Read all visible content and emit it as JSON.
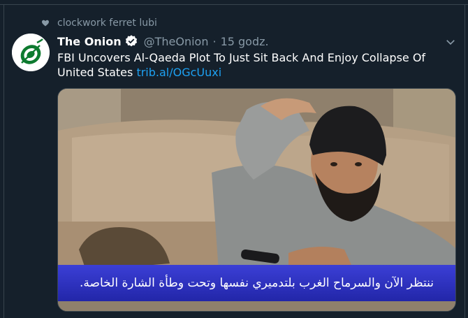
{
  "social_context": {
    "icon": "heart-icon",
    "text": "clockwork ferret lubi"
  },
  "tweet": {
    "avatar_icon": "onion-logo",
    "display_name": "The Onion",
    "verified_icon": "verified-badge-icon",
    "handle": "@TheOnion",
    "separator": "·",
    "timestamp": "15 godz.",
    "menu_icon": "chevron-down-icon",
    "text": "FBI Uncovers Al-Qaeda Plot To Just Sit Back And Enjoy Collapse Of United States ",
    "link_text": "trib.al/OGcUuxi",
    "media": {
      "caption": "ننتظر الآن والسرماح الغرب بلتدميري نفسها وتحت وطأة الشارة الخاصة."
    }
  },
  "colors": {
    "background": "#15202b",
    "muted_text": "#8899a6",
    "link": "#1da1f2",
    "border": "#38444d"
  }
}
